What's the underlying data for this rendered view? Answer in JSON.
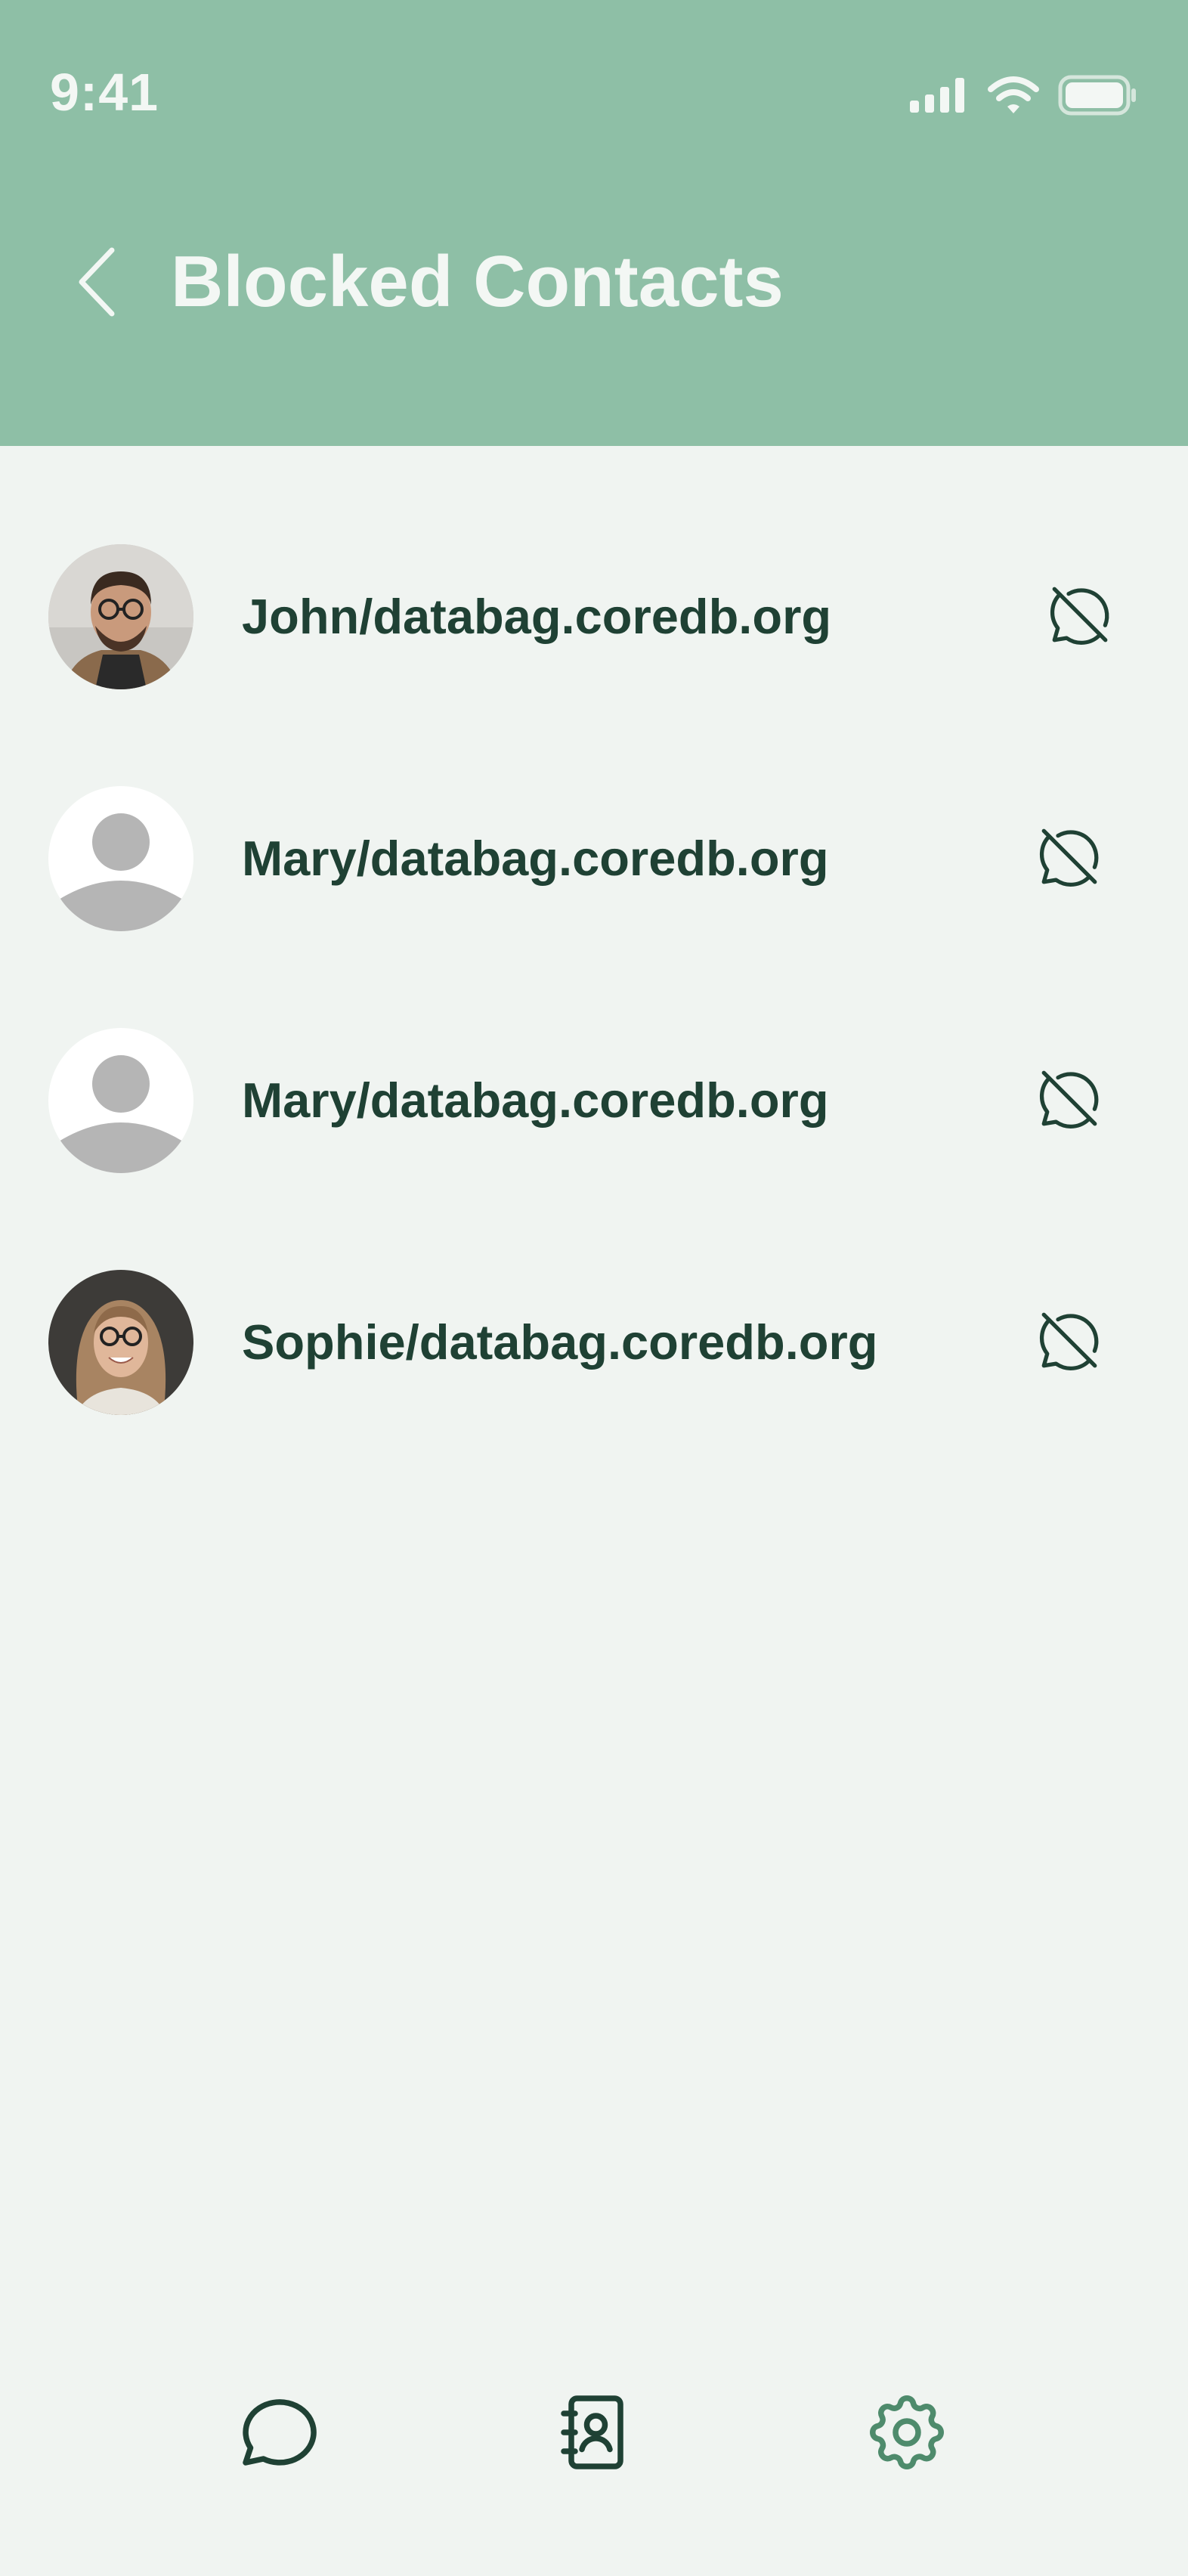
{
  "status_bar": {
    "time": "9:41",
    "icons": [
      "cellular-signal-icon",
      "wifi-icon",
      "battery-icon"
    ]
  },
  "header": {
    "title": "Blocked Contacts",
    "back_icon": "chevron-left-icon",
    "background_color": "#8ebfa6"
  },
  "contacts": [
    {
      "name": "John/databag.coredb.org",
      "avatar": "photo",
      "action_icon": "message-off-icon"
    },
    {
      "name": "Mary/databag.coredb.org",
      "avatar": "placeholder",
      "action_icon": "message-off-icon"
    },
    {
      "name": "Mary/databag.coredb.org",
      "avatar": "placeholder",
      "action_icon": "message-off-icon"
    },
    {
      "name": "Sophie/databag.coredb.org",
      "avatar": "photo",
      "action_icon": "message-off-icon"
    }
  ],
  "tab_bar": {
    "tabs": [
      {
        "icon": "chat-bubble-icon",
        "active": false
      },
      {
        "icon": "contacts-book-icon",
        "active": false
      },
      {
        "icon": "settings-gear-icon",
        "active": true
      }
    ]
  },
  "colors": {
    "background": "#f0f4f1",
    "text_dark": "#1f4134",
    "accent": "#4e8b6c",
    "header_text": "#f3f7f4"
  }
}
